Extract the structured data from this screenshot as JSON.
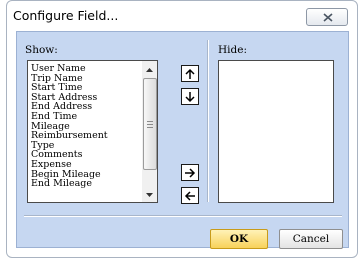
{
  "window": {
    "title": "Configure Field..."
  },
  "show": {
    "label": "Show:",
    "items": [
      "User Name",
      "Trip Name",
      "Start Time",
      "Start Address",
      "End Address",
      "End Time",
      "Mileage",
      "Reimbursement",
      "Type",
      "Comments",
      "Expense",
      "Begin Mileage",
      "End Mileage"
    ]
  },
  "hide": {
    "label": "Hide:",
    "items": []
  },
  "buttons": {
    "ok": "OK",
    "cancel": "Cancel"
  },
  "icons": {
    "close": "close-icon",
    "move_up": "arrow-up-icon",
    "move_down": "arrow-down-icon",
    "move_right": "arrow-right-icon",
    "move_left": "arrow-left-icon"
  },
  "colors": {
    "panel": "#c6d7f1",
    "ok_button": "#f8d25a"
  }
}
